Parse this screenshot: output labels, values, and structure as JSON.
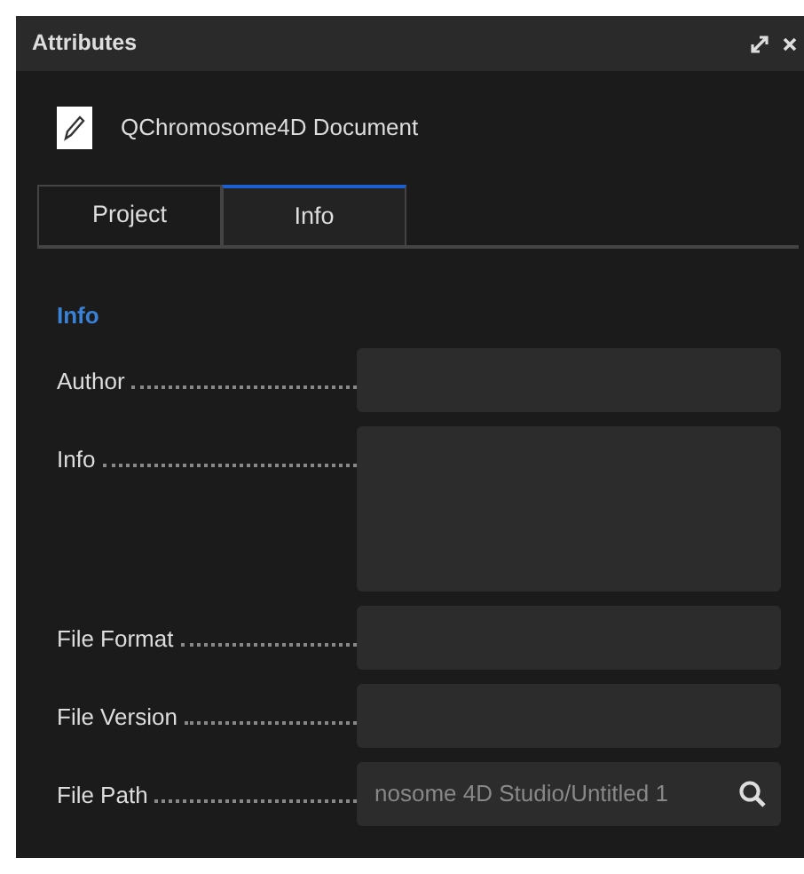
{
  "panel": {
    "title": "Attributes"
  },
  "document": {
    "name": "QChromosome4D Document"
  },
  "tabs": [
    {
      "label": "Project",
      "selected": false
    },
    {
      "label": "Info",
      "selected": true
    }
  ],
  "section": {
    "heading": "Info"
  },
  "fields": [
    {
      "label": "Author",
      "kind": "line"
    },
    {
      "label": "Info",
      "kind": "area"
    },
    {
      "label": "File Format",
      "kind": "line"
    },
    {
      "label": "File Version",
      "kind": "line"
    },
    {
      "label": "File Path",
      "kind": "path",
      "value": "nosome 4D Studio/Untitled 1"
    }
  ]
}
